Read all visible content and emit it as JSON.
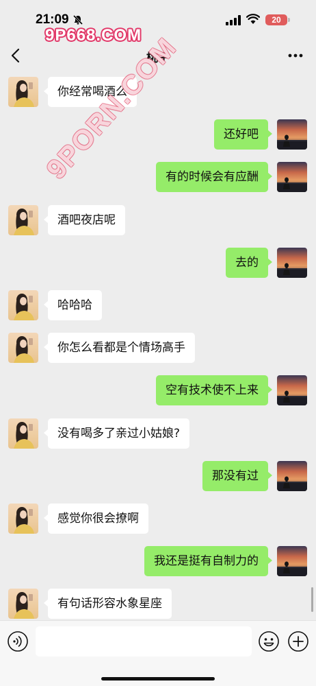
{
  "status_bar": {
    "time": "21:09",
    "battery": "20",
    "watermark": "9P668.COM",
    "icons": [
      "bell-off-icon",
      "signal-icon",
      "wifi-icon",
      "battery-icon"
    ]
  },
  "nav": {
    "title": "桃子",
    "back_icon": "chevron-left-icon",
    "more_icon": "more-dots-icon"
  },
  "overlay_watermark": "9PORN.COM",
  "messages": [
    {
      "side": "left",
      "text": "你经常喝酒么"
    },
    {
      "side": "right",
      "text": "还好吧"
    },
    {
      "side": "right",
      "text": "有的时候会有应酬"
    },
    {
      "side": "left",
      "text": "酒吧夜店呢"
    },
    {
      "side": "right",
      "text": "去的"
    },
    {
      "side": "left",
      "text": "哈哈哈"
    },
    {
      "side": "left",
      "text": "你怎么看都是个情场高手"
    },
    {
      "side": "right",
      "text": "空有技术使不上来"
    },
    {
      "side": "left",
      "text": "没有喝多了亲过小姑娘?"
    },
    {
      "side": "right",
      "text": "那没有过"
    },
    {
      "side": "left",
      "text": "感觉你很会撩啊"
    },
    {
      "side": "right",
      "text": "我还是挺有自制力的"
    },
    {
      "side": "left",
      "text": "有句话形容水象星座"
    }
  ],
  "input_bar": {
    "value": "",
    "icons": [
      "voice-icon",
      "emoji-icon",
      "plus-icon"
    ]
  },
  "colors": {
    "background": "#ededed",
    "bubble_self": "#95ec69",
    "bubble_other": "#ffffff",
    "battery": "#e05c5c"
  }
}
